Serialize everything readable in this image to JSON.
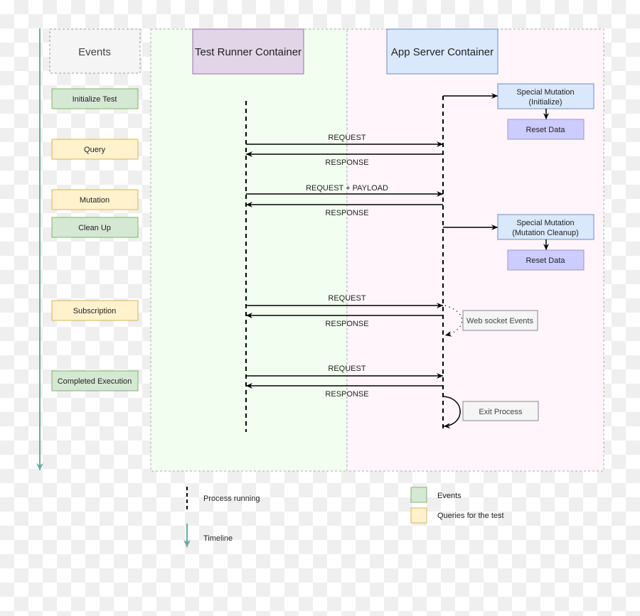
{
  "colors": {
    "timeline": "#67ab9f",
    "event_fill": "#d5e8d4",
    "event_stroke": "#82b366",
    "query_fill": "#fff2cc",
    "query_stroke": "#d6b656",
    "runner_fill": "#e1d5e7",
    "runner_stroke": "#9673a6",
    "server_fill": "#dae8fc",
    "server_stroke": "#6c8ebf",
    "reset_fill": "#ccccff",
    "reset_stroke": "#9999cc",
    "runner_area": "#f2fff0",
    "server_area": "#fff5fa"
  },
  "headers": {
    "events": "Events",
    "runner": "Test Runner Container",
    "server": "App Server Container"
  },
  "events": [
    {
      "label": "Initialize Test",
      "kind": "event"
    },
    {
      "label": "Query",
      "kind": "query"
    },
    {
      "label": "Mutation",
      "kind": "query"
    },
    {
      "label": "Clean Up",
      "kind": "event"
    },
    {
      "label": "Subscription",
      "kind": "query"
    },
    {
      "label": "Completed Execution",
      "kind": "event"
    }
  ],
  "messages": {
    "q_req": "REQUEST",
    "q_res": "RESPONSE",
    "m_req": "REQUEST + PAYLOAD",
    "m_res": "RESPONSE",
    "s_req": "REQUEST",
    "s_res": "RESPONSE",
    "c_req": "REQUEST",
    "c_res": "RESPONSE"
  },
  "server_boxes": {
    "init_mutation": [
      "Special Mutation",
      "(Initialize)"
    ],
    "init_reset": "Reset Data",
    "clean_mutation": [
      "Special Mutation",
      "(Mutation Cleanup)"
    ],
    "clean_reset": "Reset Data",
    "websocket": "Web socket Events",
    "exit": "Exit Process"
  },
  "legend": {
    "process": "Process running",
    "timeline": "Timeline",
    "events": "Events",
    "queries": "Queries for the test"
  }
}
